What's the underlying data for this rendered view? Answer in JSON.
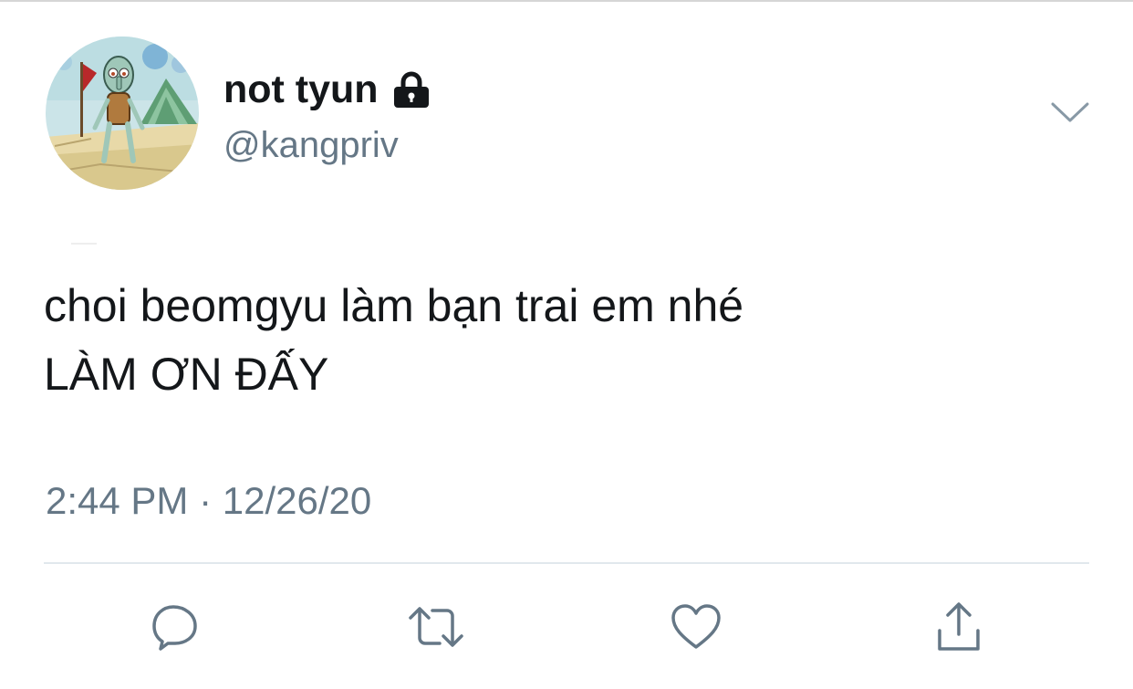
{
  "tweet": {
    "display_name": "not tyun",
    "handle": "@kangpriv",
    "text_line_1": "choi beomgyu làm bạn trai em nhé",
    "text_line_2": "LÀM ƠN ĐẤY",
    "timestamp": "2:44 PM · 12/26/20",
    "protected_account": true
  },
  "icons": {
    "lock": "lock-icon",
    "more": "chevron-down-icon",
    "reply": "reply-bubble-icon",
    "retweet": "retweet-icon",
    "like": "heart-icon",
    "share": "share-upload-icon"
  },
  "colors": {
    "text_primary": "#14171a",
    "text_secondary": "#657786",
    "divider": "#e1e8ed",
    "background": "#ffffff"
  }
}
